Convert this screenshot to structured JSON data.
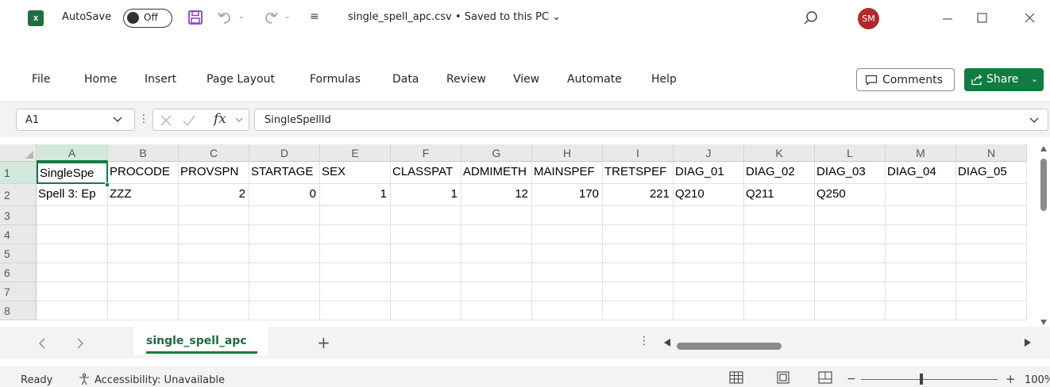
{
  "titlebar": {
    "app_icon_letter": "x",
    "autosave_label": "AutoSave",
    "autosave_state": "Off",
    "doc_title": "single_spell_apc.csv • Saved to this PC",
    "user_initials": "SM"
  },
  "ribbon": {
    "tabs": [
      "File",
      "Home",
      "Insert",
      "Page Layout",
      "Formulas",
      "Data",
      "Review",
      "View",
      "Automate",
      "Help"
    ],
    "comments_label": "Comments",
    "share_label": "Share"
  },
  "formula_bar": {
    "name_box": "A1",
    "fx_label": "fx",
    "content": "SingleSpellId"
  },
  "grid": {
    "columns": [
      "A",
      "B",
      "C",
      "D",
      "E",
      "F",
      "G",
      "H",
      "I",
      "J",
      "K",
      "L",
      "M",
      "N"
    ],
    "row_numbers": [
      "1",
      "2",
      "3",
      "4",
      "5",
      "6",
      "7",
      "8"
    ],
    "rows": [
      [
        "SingleSpe",
        "PROCODE",
        "PROVSPN",
        "STARTAGE",
        "SEX",
        "CLASSPAT",
        "ADMIMETH",
        "MAINSPEF",
        "TRETSPEF",
        "DIAG_01",
        "DIAG_02",
        "DIAG_03",
        "DIAG_04",
        "DIAG_05"
      ],
      [
        "Spell 3: Ep",
        "ZZZ",
        "2",
        "0",
        "1",
        "1",
        "12",
        "170",
        "221",
        "Q210",
        "Q211",
        "Q250",
        "",
        ""
      ]
    ],
    "numeric_cells": [
      [
        1,
        2
      ],
      [
        1,
        3
      ],
      [
        1,
        4
      ],
      [
        1,
        5
      ],
      [
        1,
        6
      ],
      [
        1,
        7
      ],
      [
        1,
        8
      ]
    ],
    "active_cell": "A1"
  },
  "sheets": {
    "active_sheet": "single_spell_apc",
    "add_label": "+"
  },
  "status": {
    "ready": "Ready",
    "accessibility": "Accessibility: Unavailable",
    "zoom": "100%"
  },
  "colors": {
    "excel_green": "#107c41",
    "avatar_red": "#b3282d",
    "save_icon_purple": "#8f3fc0"
  }
}
